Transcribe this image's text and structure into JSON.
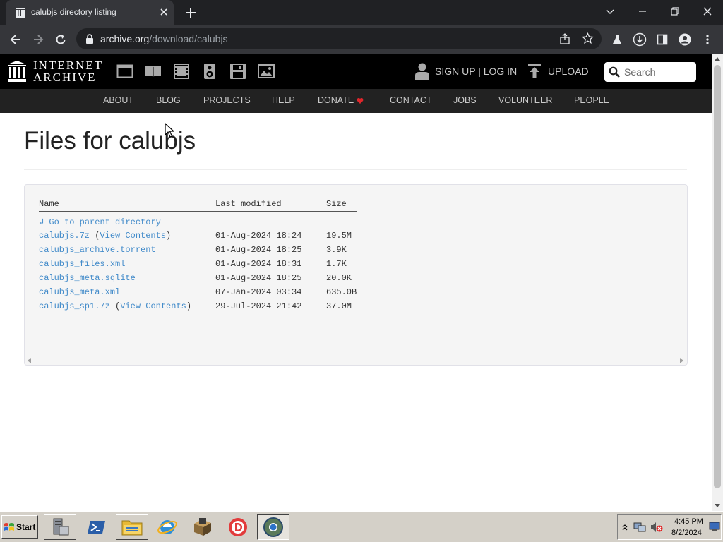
{
  "browser": {
    "tab_title": "calubjs directory listing",
    "url_host": "archive.org",
    "url_path": "/download/calubjs"
  },
  "ia_header": {
    "wordmark_line1": "INTERNET",
    "wordmark_line2": "ARCHIVE",
    "media_icons": [
      "web-icon",
      "texts-icon",
      "video-icon",
      "audio-icon",
      "software-icon",
      "images-icon"
    ],
    "signup_login": "SIGN UP | LOG IN",
    "upload": "UPLOAD",
    "search_placeholder": "Search"
  },
  "ia_nav": [
    "ABOUT",
    "BLOG",
    "PROJECTS",
    "HELP",
    "DONATE",
    "CONTACT",
    "JOBS",
    "VOLUNTEER",
    "PEOPLE"
  ],
  "page": {
    "title": "Files for calubjs"
  },
  "listing": {
    "headers": {
      "name": "Name",
      "modified": "Last modified",
      "size": "Size"
    },
    "parent_link": "↲ Go to parent directory",
    "rows": [
      {
        "name": "calubjs.7z",
        "view_contents": "View Contents",
        "modified": "01-Aug-2024 18:24",
        "size": "19.5M"
      },
      {
        "name": "calubjs_archive.torrent",
        "view_contents": "",
        "modified": "01-Aug-2024 18:25",
        "size": "3.9K"
      },
      {
        "name": "calubjs_files.xml",
        "view_contents": "",
        "modified": "01-Aug-2024 18:31",
        "size": "1.7K"
      },
      {
        "name": "calubjs_meta.sqlite",
        "view_contents": "",
        "modified": "01-Aug-2024 18:25",
        "size": "20.0K"
      },
      {
        "name": "calubjs_meta.xml",
        "view_contents": "",
        "modified": "07-Jan-2024 03:34",
        "size": "635.0B"
      },
      {
        "name": "calubjs_sp1.7z",
        "view_contents": "View Contents",
        "modified": "29-Jul-2024 21:42",
        "size": "37.0M"
      }
    ]
  },
  "taskbar": {
    "start_label": "Start",
    "clock_time": "4:45 PM",
    "clock_date": "8/2/2024"
  },
  "colors": {
    "link": "#428bca",
    "ia_black": "#000000",
    "ia_nav": "#222222",
    "donate_heart": "#e0262b",
    "chrome_dark": "#202124"
  }
}
